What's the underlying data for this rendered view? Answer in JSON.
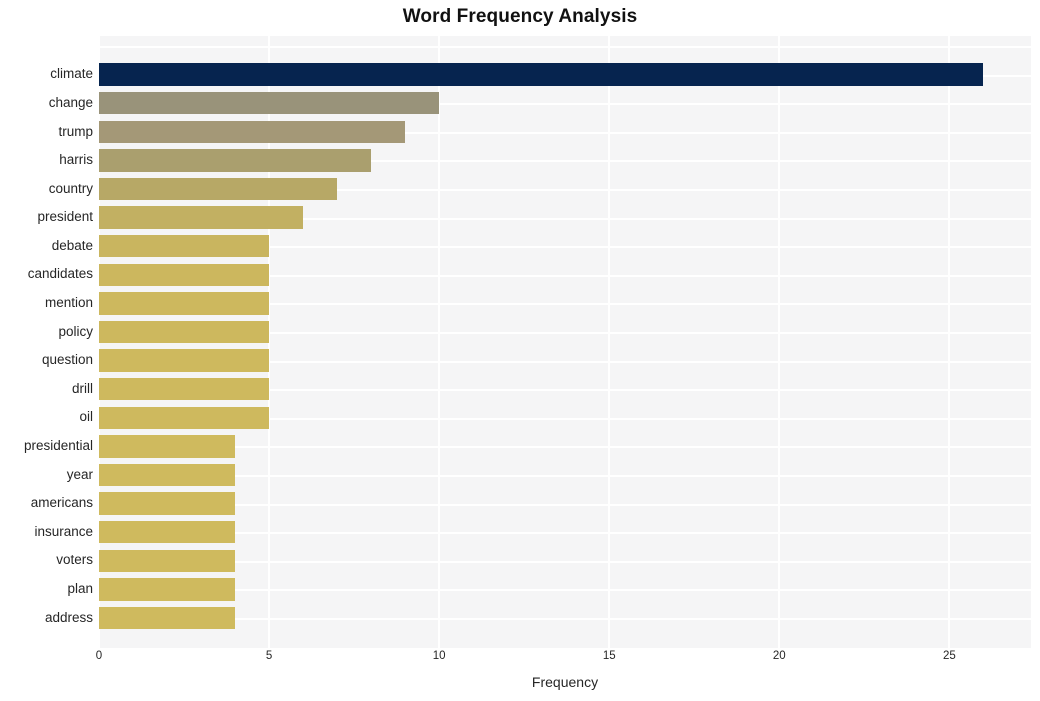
{
  "chart_data": {
    "type": "bar",
    "orientation": "horizontal",
    "title": "Word Frequency Analysis",
    "xlabel": "Frequency",
    "ylabel": "",
    "xlim": [
      0,
      27.4
    ],
    "xticks": [
      0,
      5,
      10,
      15,
      20,
      25
    ],
    "xtick_labels": [
      "0",
      "5",
      "10",
      "15",
      "20",
      "25"
    ],
    "grid": true,
    "legend": "none",
    "plot_background": "#f5f5f6",
    "grid_color": "#ffffff",
    "categories": [
      "climate",
      "change",
      "trump",
      "harris",
      "country",
      "president",
      "debate",
      "candidates",
      "mention",
      "policy",
      "question",
      "drill",
      "oil",
      "presidential",
      "year",
      "americans",
      "insurance",
      "voters",
      "plan",
      "address"
    ],
    "values": [
      26,
      10,
      9,
      8,
      7,
      6,
      5,
      5,
      5,
      5,
      5,
      5,
      5,
      4,
      4,
      4,
      4,
      4,
      4,
      4
    ],
    "bar_colors": [
      "#06244f",
      "#99937a",
      "#a49877",
      "#aa9f6e",
      "#b7a866",
      "#c2b062",
      "#c9b55f",
      "#ccb75e",
      "#cdb85e",
      "#cdb85e",
      "#ceb95e",
      "#ceb95e",
      "#ceb95e",
      "#cfba5e",
      "#cfba5e",
      "#cfba5e",
      "#cfba5e",
      "#cfba5e",
      "#cfba5e",
      "#cfba5e"
    ]
  },
  "axis": {
    "title_color": "#111111",
    "tick_color": "#262626"
  }
}
